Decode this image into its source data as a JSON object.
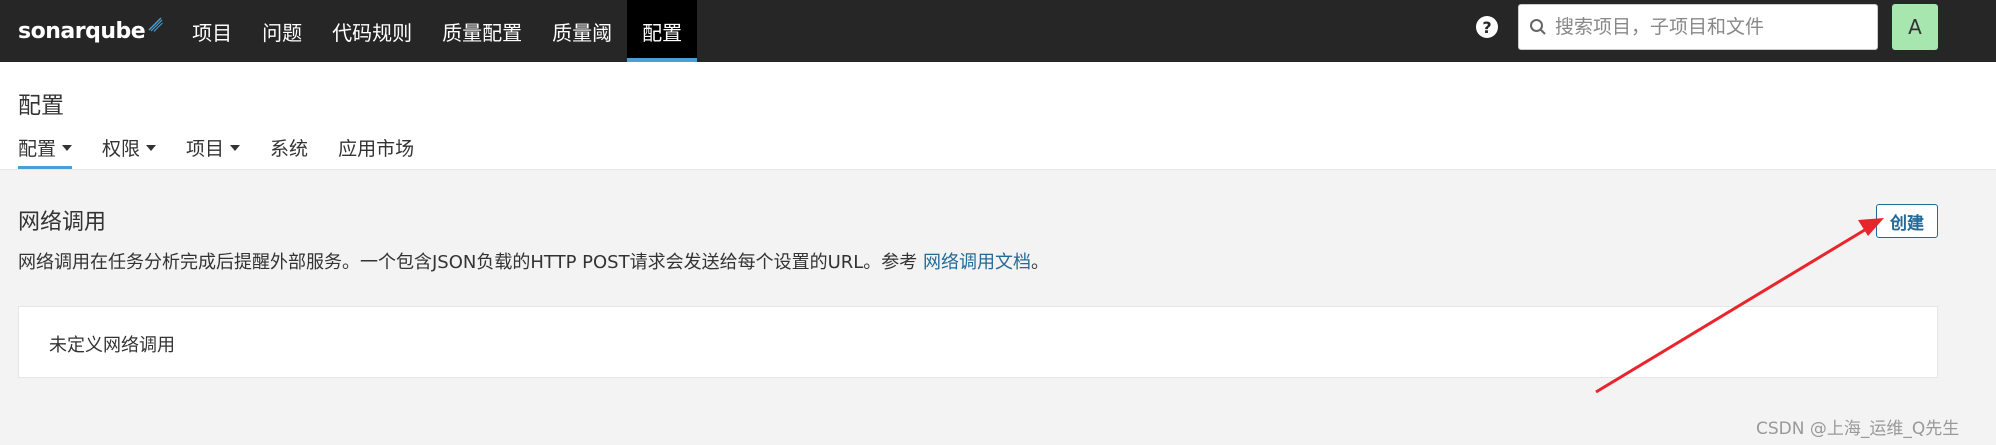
{
  "topnav": {
    "logo": "sonarqube",
    "items": [
      {
        "label": "项目"
      },
      {
        "label": "问题"
      },
      {
        "label": "代码规则"
      },
      {
        "label": "质量配置"
      },
      {
        "label": "质量阈"
      },
      {
        "label": "配置",
        "active": true
      }
    ],
    "help_glyph": "?",
    "search_placeholder": "搜索项目，子项目和文件",
    "avatar_letter": "A"
  },
  "page": {
    "title": "配置",
    "tabs": [
      {
        "label": "配置"
      },
      {
        "label": "权限"
      },
      {
        "label": "项目"
      },
      {
        "label": "系统"
      },
      {
        "label": "应用市场"
      }
    ]
  },
  "webhooks": {
    "title": "网络调用",
    "create_label": "创建",
    "description_prefix": "网络调用在任务分析完成后提醒外部服务。一个包含JSON负载的HTTP POST请求会发送给每个设置的URL。参考 ",
    "doc_link": "网络调用文档",
    "description_suffix": "。",
    "empty_text": "未定义网络调用"
  },
  "watermark": "CSDN @上海_运维_Q先生",
  "colors": {
    "nav_bg": "#262626",
    "accent": "#4b9fd5",
    "link": "#236a97",
    "avatar_bg": "#a8e6b0",
    "arrow": "#e8252b"
  },
  "icons": {
    "help": "help-circle-icon",
    "search": "search-icon",
    "logo_mark": "sonar-waves-icon"
  }
}
